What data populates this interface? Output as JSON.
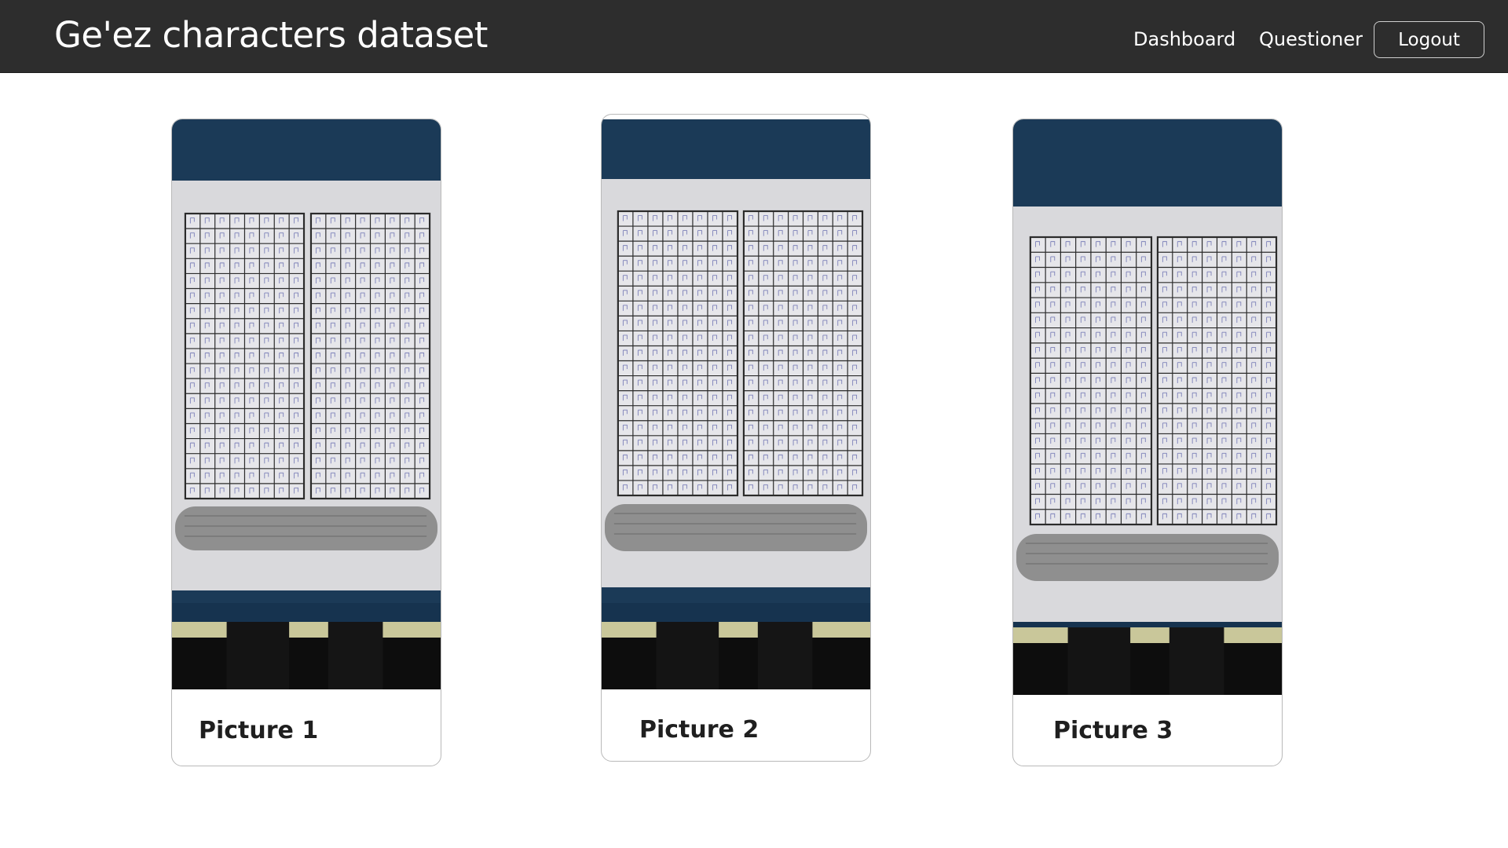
{
  "header": {
    "brand": "Ge'ez characters dataset",
    "nav": {
      "dashboard": "Dashboard",
      "questioner": "Questioner",
      "logout": "Logout"
    }
  },
  "pictures": [
    {
      "title": "Picture 1",
      "image": "photo of handwritten Ge'ez character grid sheet"
    },
    {
      "title": "Picture 2",
      "image": "photo of handwritten Ge'ez character grid sheet"
    },
    {
      "title": "Picture 3",
      "image": "photo of handwritten Ge'ez character grid sheet"
    }
  ],
  "colors": {
    "navbar_bg": "#2d2d2d",
    "navbar_text": "#ffffff",
    "card_border": "#b9b9b9",
    "photo_fabric": "#1b3a57",
    "photo_paper": "#d9d9dc",
    "grid_line": "#2b2b2b",
    "ink": "#5a5fa8"
  }
}
